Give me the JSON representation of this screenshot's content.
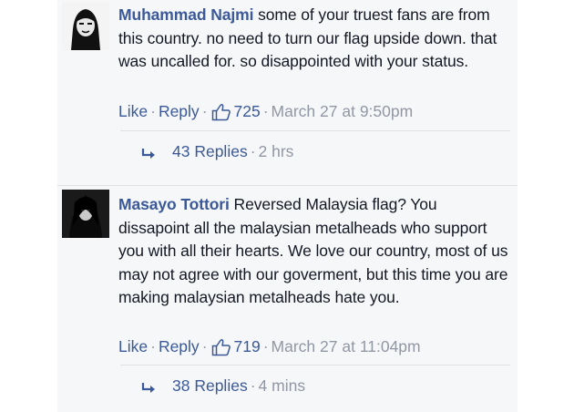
{
  "comments": [
    {
      "author": "Muhammad Najmi",
      "text": "some of your truest fans are from this country. no need to turn our flag upside down. that was uncalled for. so disappointed with your status.",
      "like_label": "Like",
      "reply_label": "Reply",
      "like_count": "725",
      "timestamp": "March 27 at 9:50pm",
      "replies_label": "43 Replies",
      "replies_time": "2 hrs"
    },
    {
      "author": "Masayo Tottori",
      "text": "Reversed Malaysia flag? You dissapoint all the malaysian metalheads who support you with all their hearts. We love our country, most of us may not agree with our goverment, but this time you are making malaysian metalheads hate you.",
      "like_label": "Like",
      "reply_label": "Reply",
      "like_count": "719",
      "timestamp": "March 27 at 11:04pm",
      "replies_label": "38 Replies",
      "replies_time": "4 mins"
    }
  ],
  "separator": "·",
  "icons": {
    "like": "thumbs-up-icon",
    "reply": "reply-arrow-icon"
  },
  "colors": {
    "link": "#3b5998",
    "text": "#141823",
    "meta": "#9197a3",
    "panel": "#f6f7f9"
  }
}
